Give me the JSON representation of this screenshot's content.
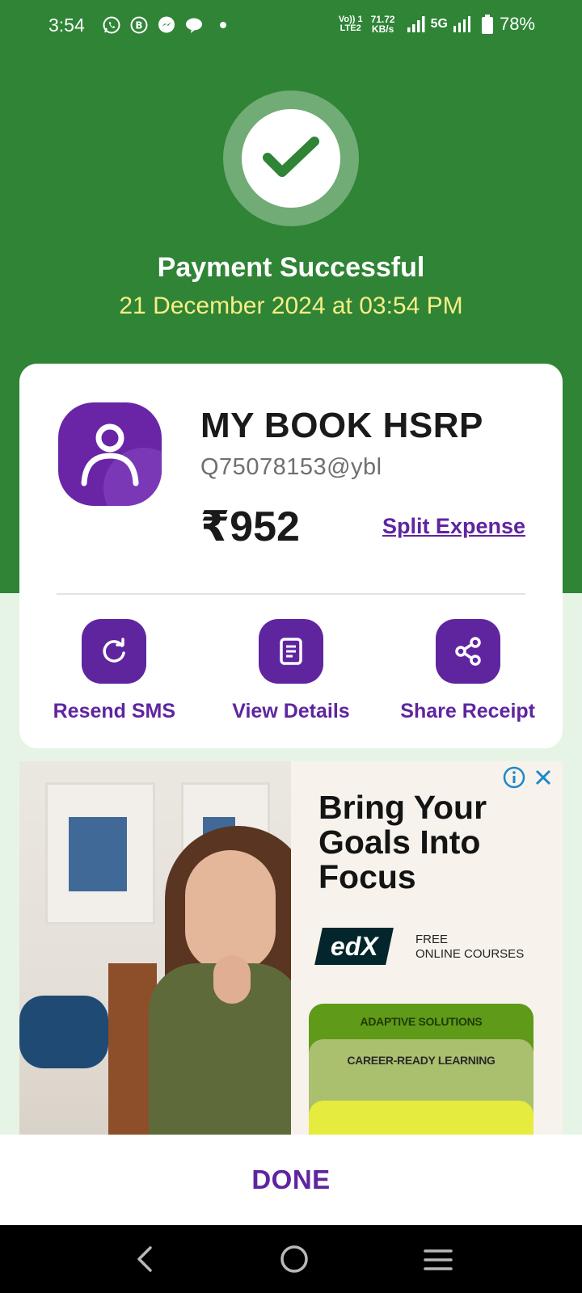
{
  "status_bar": {
    "time": "3:54",
    "volte": "Vo)) 1",
    "lte": "LTE2",
    "speed_value": "71.72",
    "speed_unit": "KB/s",
    "network": "5G",
    "battery": "78%",
    "app_icons": [
      "whatsapp-icon",
      "whatsapp-business-icon",
      "messenger-icon",
      "chat-icon"
    ]
  },
  "header": {
    "title": "Payment Successful",
    "datetime": "21 December 2024 at 03:54 PM"
  },
  "payee": {
    "name": "MY BOOK HSRP",
    "upi_id": "Q75078153@ybl",
    "amount": "₹952",
    "split_label": "Split Expense"
  },
  "actions": [
    {
      "label": "Resend SMS",
      "icon": "refresh-icon"
    },
    {
      "label": "View Details",
      "icon": "document-icon"
    },
    {
      "label": "Share Receipt",
      "icon": "share-icon"
    }
  ],
  "ad": {
    "headline": "Bring Your Goals Into Focus",
    "brand": "edX",
    "brand_line1": "FREE",
    "brand_line2": "ONLINE COURSES",
    "tag1": "ADAPTIVE SOLUTIONS",
    "tag2": "CAREER-READY LEARNING"
  },
  "footer": {
    "done_label": "DONE"
  },
  "colors": {
    "hero_green": "#2f8436",
    "brand_purple": "#5f259f",
    "date_yellow": "#f8ee86",
    "check_green": "#2f8436"
  }
}
